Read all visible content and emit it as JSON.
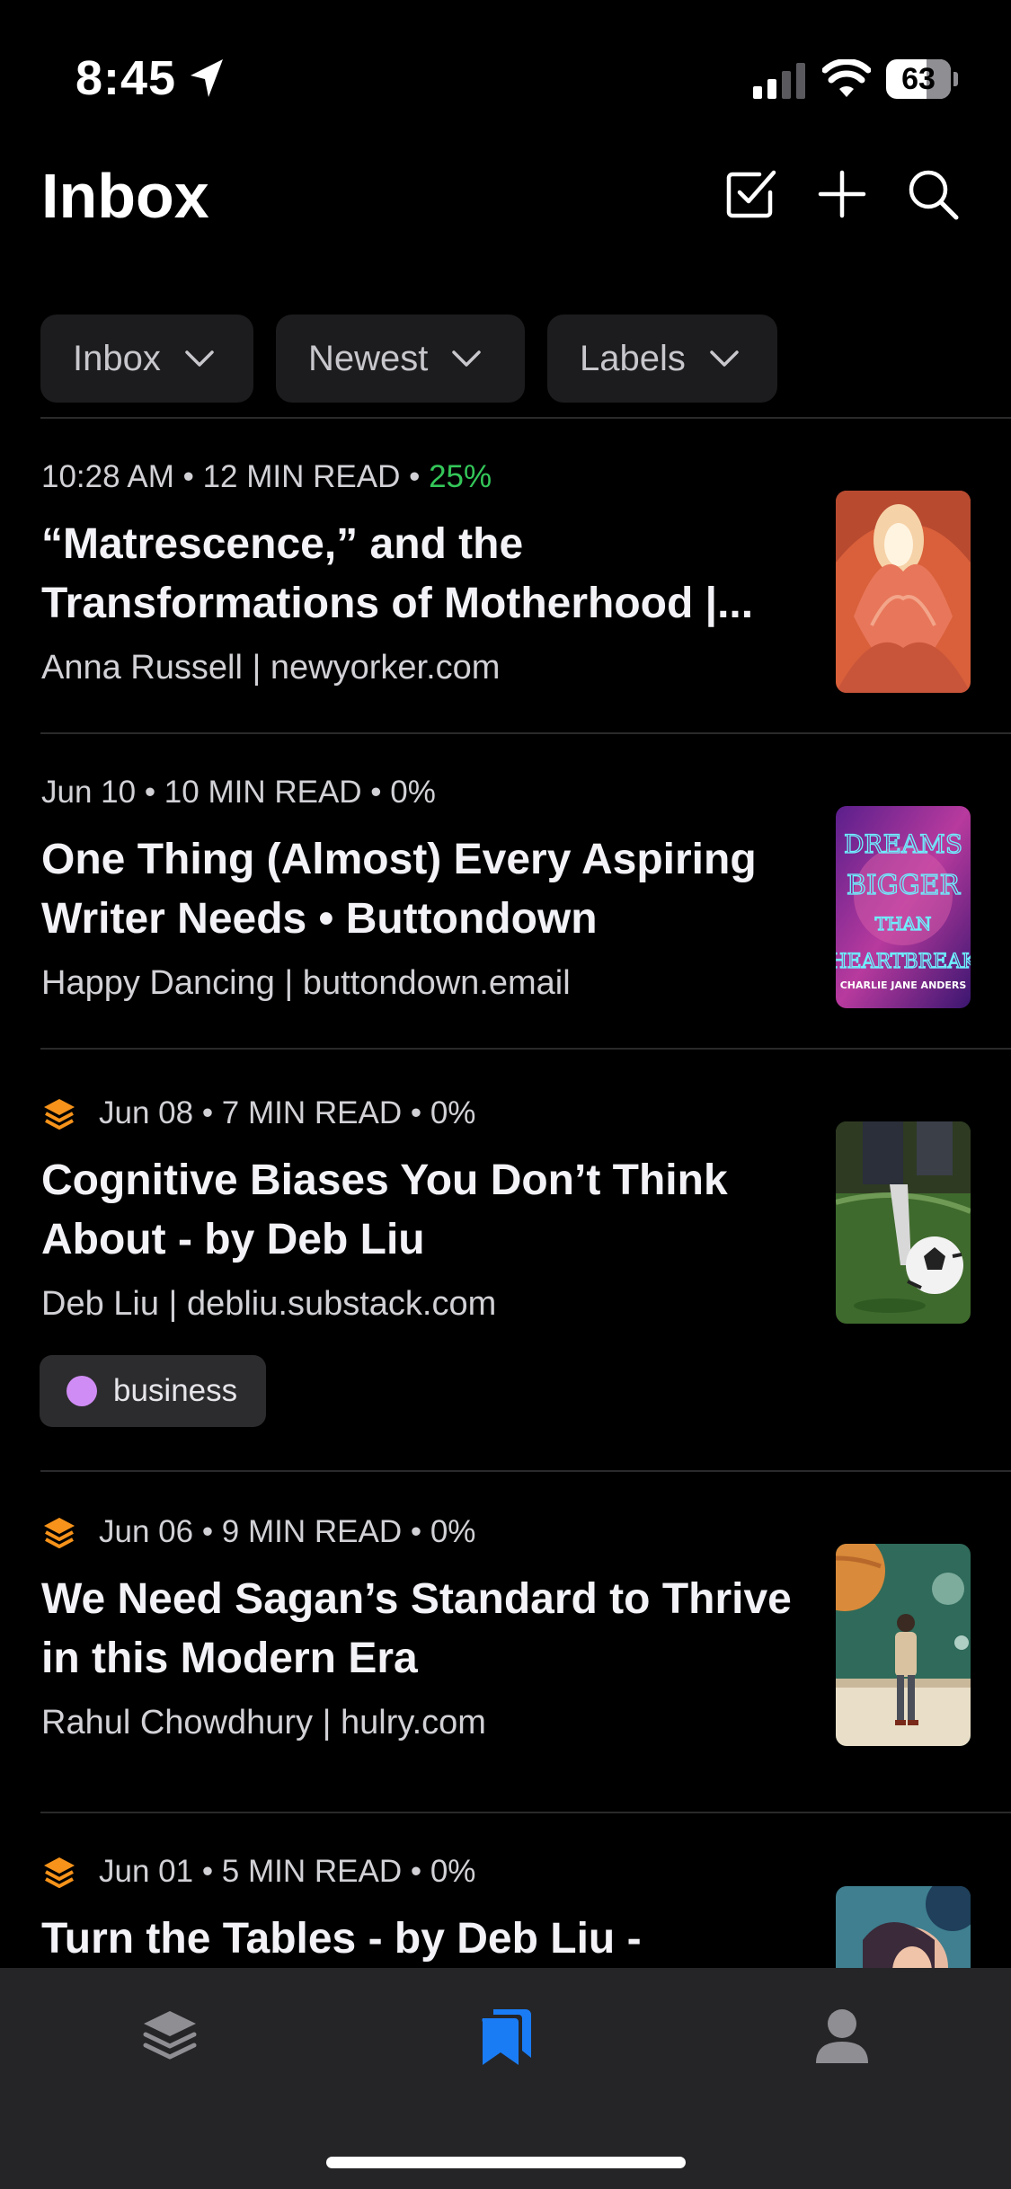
{
  "status_bar": {
    "time": "8:45",
    "battery": "63",
    "battery_level": 0.63
  },
  "header": {
    "title": "Inbox",
    "icons": [
      "checkbox-icon",
      "plus-icon",
      "search-icon"
    ]
  },
  "filters": [
    {
      "label": "Inbox"
    },
    {
      "label": "Newest"
    },
    {
      "label": "Labels"
    }
  ],
  "articles": [
    {
      "date": "10:28 AM",
      "read_time": "12 MIN READ",
      "progress": "25%",
      "progress_color": "#34c759",
      "title": "“Matrescence,” and the Transformations of Motherhood |...",
      "byline": "Anna Russell | newyorker.com"
    },
    {
      "date": "Jun 10",
      "read_time": "10 MIN READ",
      "progress": "0%",
      "title": "One Thing (Almost) Every Aspiring Writer Needs • Buttondown",
      "byline": "Happy Dancing | buttondown.email",
      "thumb_text": [
        "DREAMS",
        "BIGGER",
        "THAN",
        "HEARTBREAK",
        "CHARLIE JANE ANDERS"
      ]
    },
    {
      "date": "Jun 08",
      "read_time": "7 MIN READ",
      "progress": "0%",
      "icon": "substack-stack-icon",
      "title": "Cognitive Biases You Don’t Think About - by Deb Liu",
      "byline": "Deb Liu | debliu.substack.com",
      "label": {
        "name": "business",
        "color": "#d08cf5"
      }
    },
    {
      "date": "Jun 06",
      "read_time": "9 MIN READ",
      "progress": "0%",
      "icon": "substack-stack-icon",
      "title": "We Need Sagan’s Standard to Thrive in this Modern Era",
      "byline": "Rahul Chowdhury | hulry.com"
    },
    {
      "date": "Jun 01",
      "read_time": "5 MIN READ",
      "progress": "0%",
      "icon": "substack-stack-icon",
      "title": "Turn the Tables - by Deb Liu -",
      "byline": ""
    }
  ],
  "tab_bar": {
    "tabs": [
      "library-stack-icon",
      "bookmarks-icon",
      "profile-icon"
    ],
    "active": "bookmarks-icon",
    "active_color": "#1a7cf5",
    "inactive_color": "#8e8e93"
  },
  "colors": {
    "accent_orange": "#f7931a",
    "background": "#000000",
    "chip_bg": "#1c1c1e"
  }
}
